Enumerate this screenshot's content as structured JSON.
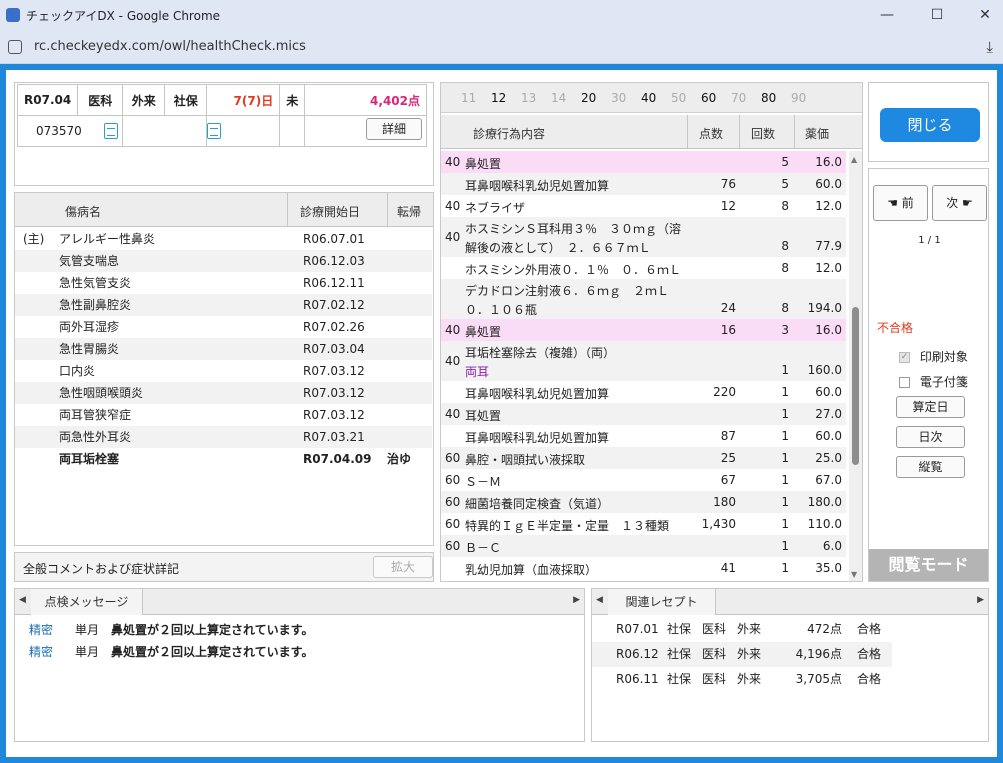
{
  "browser": {
    "title": "チェックアイDX - Google Chrome",
    "url": "rc.checkeyedx.com/owl/healthCheck.mics",
    "minimize": "—",
    "maximize": "☐",
    "close": "✕"
  },
  "patient": {
    "date": "R07.04",
    "dept": "医科",
    "visit": "外来",
    "insurance": "社保",
    "days": "7(7)日",
    "flag": "未",
    "points": "4,402点",
    "patient_id": "073570",
    "detail_button": "詳細"
  },
  "disease_list": {
    "headers": {
      "name": "傷病名",
      "start": "診療開始日",
      "outcome": "転帰"
    },
    "rows": [
      {
        "prefix": "(主)",
        "name": "アレルギー性鼻炎",
        "start": "R06.07.01",
        "outcome": ""
      },
      {
        "prefix": "",
        "name": "気管支喘息",
        "start": "R06.12.03",
        "outcome": ""
      },
      {
        "prefix": "",
        "name": "急性気管支炎",
        "start": "R06.12.11",
        "outcome": ""
      },
      {
        "prefix": "",
        "name": "急性副鼻腔炎",
        "start": "R07.02.12",
        "outcome": ""
      },
      {
        "prefix": "",
        "name": "両外耳湿疹",
        "start": "R07.02.26",
        "outcome": ""
      },
      {
        "prefix": "",
        "name": "急性胃腸炎",
        "start": "R07.03.04",
        "outcome": ""
      },
      {
        "prefix": "",
        "name": "口内炎",
        "start": "R07.03.12",
        "outcome": ""
      },
      {
        "prefix": "",
        "name": "急性咽頭喉頭炎",
        "start": "R07.03.12",
        "outcome": ""
      },
      {
        "prefix": "",
        "name": "両耳管狭窄症",
        "start": "R07.03.12",
        "outcome": ""
      },
      {
        "prefix": "",
        "name": "両急性外耳炎",
        "start": "R07.03.21",
        "outcome": ""
      },
      {
        "prefix": "",
        "name": "両耳垢栓塞",
        "start": "R07.04.09",
        "outcome": "治ゆ"
      }
    ]
  },
  "comment": {
    "label": "全般コメントおよび症状詳記",
    "expand_button": "拡大"
  },
  "treatment": {
    "tabs": [
      "11",
      "12",
      "13",
      "14",
      "20",
      "30",
      "40",
      "50",
      "60",
      "70",
      "80",
      "90"
    ],
    "headers": {
      "content": "診療行為内容",
      "points": "点数",
      "count": "回数",
      "price": "薬価"
    },
    "rows": [
      {
        "code": "40",
        "name": "鼻処置",
        "sub": "",
        "points": "",
        "count": "5",
        "price": "16.0"
      },
      {
        "code": "",
        "name": "耳鼻咽喉科乳幼児処置加算",
        "sub": "",
        "points": "76",
        "count": "5",
        "price": "60.0"
      },
      {
        "code": "40",
        "name": "ネブライザ",
        "sub": "",
        "points": "12",
        "count": "8",
        "price": "12.0"
      },
      {
        "code": "40",
        "name": "ホスミシンＳ耳科用３％　３０ｍｇ（溶",
        "sub": "解後の液として）　２．６６７ｍＬ",
        "points": "",
        "count": "8",
        "price": "77.9"
      },
      {
        "code": "",
        "name": "ホスミシン外用液０．１％　０．６ｍＬ",
        "sub": "",
        "points": "",
        "count": "8",
        "price": "12.0"
      },
      {
        "code": "",
        "name": "デカドロン注射液６．６ｍｇ　２ｍＬ",
        "sub": "０．１０６瓶",
        "points": "24",
        "count": "8",
        "price": "194.0"
      },
      {
        "code": "40",
        "name": "鼻処置",
        "sub": "",
        "points": "16",
        "count": "3",
        "price": "16.0"
      },
      {
        "code": "40",
        "name": "耳垢栓塞除去（複雑）（両）",
        "sub": "両耳",
        "points": "",
        "count": "1",
        "price": "160.0"
      },
      {
        "code": "",
        "name": "耳鼻咽喉科乳幼児処置加算",
        "sub": "",
        "points": "220",
        "count": "1",
        "price": "60.0"
      },
      {
        "code": "40",
        "name": "耳処置",
        "sub": "",
        "points": "",
        "count": "1",
        "price": "27.0"
      },
      {
        "code": "",
        "name": "耳鼻咽喉科乳幼児処置加算",
        "sub": "",
        "points": "87",
        "count": "1",
        "price": "60.0"
      },
      {
        "code": "60",
        "name": "鼻腔・咽頭拭い液採取",
        "sub": "",
        "points": "25",
        "count": "1",
        "price": "25.0"
      },
      {
        "code": "60",
        "name": "Ｓ－Ｍ",
        "sub": "",
        "points": "67",
        "count": "1",
        "price": "67.0"
      },
      {
        "code": "60",
        "name": "細菌培養同定検査（気道）",
        "sub": "",
        "points": "180",
        "count": "1",
        "price": "180.0"
      },
      {
        "code": "60",
        "name": "特異的ＩｇＥ半定量・定量　１３種類",
        "sub": "",
        "points": "1,430",
        "count": "1",
        "price": "110.0"
      },
      {
        "code": "60",
        "name": "Ｂ－Ｃ",
        "sub": "",
        "points": "",
        "count": "1",
        "price": "6.0"
      },
      {
        "code": "",
        "name": "乳幼児加算（血液採取）",
        "sub": "",
        "points": "41",
        "count": "1",
        "price": "35.0"
      }
    ]
  },
  "side": {
    "close_button": "閉じる",
    "prev_button": "前",
    "next_button": "次",
    "page": "1 / 1",
    "status": "不合格",
    "print_check": "印刷対象",
    "attach_check": "電子付箋",
    "calc_date_button": "算定日",
    "daily_button": "日次",
    "vertical_button": "縦覧",
    "mode_label": "閲覧モード"
  },
  "messages": {
    "tab": "点検メッセージ",
    "rows": [
      {
        "type": "精密",
        "period": "単月",
        "text": "鼻処置が２回以上算定されています。"
      },
      {
        "type": "精密",
        "period": "単月",
        "text": "鼻処置が２回以上算定されています。"
      }
    ]
  },
  "related": {
    "tab": "関連レセプト",
    "rows": [
      {
        "date": "R07.01",
        "ins": "社保",
        "dept": "医科",
        "visit": "外来",
        "points": "472点",
        "result": "合格"
      },
      {
        "date": "R06.12",
        "ins": "社保",
        "dept": "医科",
        "visit": "外来",
        "points": "4,196点",
        "result": "合格"
      },
      {
        "date": "R06.11",
        "ins": "社保",
        "dept": "医科",
        "visit": "外来",
        "points": "3,705点",
        "result": "合格"
      }
    ]
  }
}
